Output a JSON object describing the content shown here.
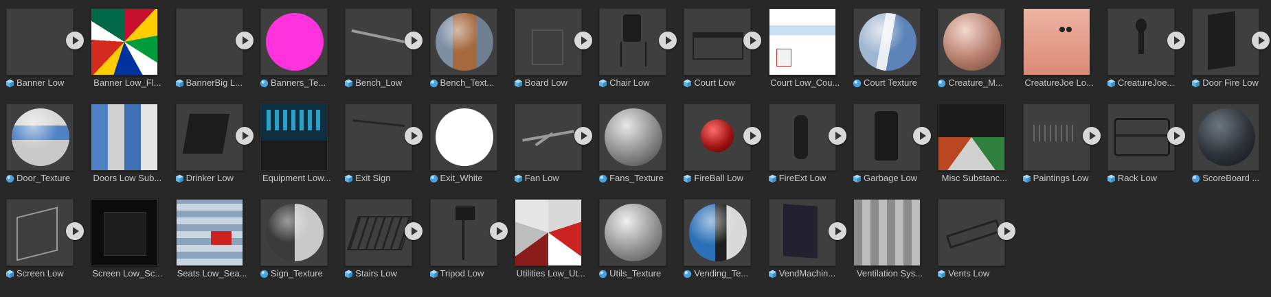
{
  "assets": [
    {
      "name": "Banner Low",
      "kind": "model",
      "thumb": "empty"
    },
    {
      "name": "Banner Low_Fl...",
      "kind": "texture",
      "thumb": "flags"
    },
    {
      "name": "BannerBig L...",
      "kind": "model",
      "thumb": "empty"
    },
    {
      "name": "Banners_Te...",
      "kind": "material",
      "thumb": "sphere-flags"
    },
    {
      "name": "Bench_Low",
      "kind": "model",
      "thumb": "bench"
    },
    {
      "name": "Bench_Text...",
      "kind": "material",
      "thumb": "sphere-bench"
    },
    {
      "name": "Board Low",
      "kind": "model",
      "thumb": "board"
    },
    {
      "name": "Chair Low",
      "kind": "model",
      "thumb": "chair"
    },
    {
      "name": "Court Low",
      "kind": "model",
      "thumb": "court"
    },
    {
      "name": "Court Low_Cou...",
      "kind": "texture",
      "thumb": "court-tex"
    },
    {
      "name": "Court Texture",
      "kind": "material",
      "thumb": "sphere-court"
    },
    {
      "name": "Creature_M...",
      "kind": "material",
      "thumb": "sphere-creature"
    },
    {
      "name": "CreatureJoe Lo...",
      "kind": "texture",
      "thumb": "creature-tex"
    },
    {
      "name": "CreatureJoe...",
      "kind": "model",
      "thumb": "creature"
    },
    {
      "name": "Door Fire Low",
      "kind": "model",
      "thumb": "door"
    },
    {
      "name": "Door_Texture",
      "kind": "material",
      "thumb": "sphere-door"
    },
    {
      "name": "Doors Low Sub...",
      "kind": "texture",
      "thumb": "doors-tex"
    },
    {
      "name": "Drinker Low",
      "kind": "model",
      "thumb": "drinker"
    },
    {
      "name": "Equipment Low...",
      "kind": "texture",
      "thumb": "equipment-tex"
    },
    {
      "name": "Exit Sign",
      "kind": "model",
      "thumb": "exitsign"
    },
    {
      "name": "Exit_White",
      "kind": "material",
      "thumb": "sphere-white"
    },
    {
      "name": "Fan Low",
      "kind": "model",
      "thumb": "fan"
    },
    {
      "name": "Fans_Texture",
      "kind": "material",
      "thumb": "sphere-fans"
    },
    {
      "name": "FireBall Low",
      "kind": "model",
      "thumb": "fireball"
    },
    {
      "name": "FireExt Low",
      "kind": "model",
      "thumb": "fireext"
    },
    {
      "name": "Garbage Low",
      "kind": "model",
      "thumb": "garbage"
    },
    {
      "name": "Misc Substanc...",
      "kind": "texture",
      "thumb": "misc-tex"
    },
    {
      "name": "Paintings Low",
      "kind": "model",
      "thumb": "paintings"
    },
    {
      "name": "Rack Low",
      "kind": "model",
      "thumb": "rack"
    },
    {
      "name": "ScoreBoard ...",
      "kind": "material",
      "thumb": "sphere-score"
    },
    {
      "name": "Screen Low",
      "kind": "model",
      "thumb": "screen"
    },
    {
      "name": "Screen Low_Sc...",
      "kind": "texture",
      "thumb": "screen-tex"
    },
    {
      "name": "Seats Low_Sea...",
      "kind": "texture",
      "thumb": "seats-tex"
    },
    {
      "name": "Sign_Texture",
      "kind": "material",
      "thumb": "sphere-sign"
    },
    {
      "name": "Stairs Low",
      "kind": "model",
      "thumb": "stairs"
    },
    {
      "name": "Tripod Low",
      "kind": "model",
      "thumb": "tripod"
    },
    {
      "name": "Utilities Low_Ut...",
      "kind": "texture",
      "thumb": "utilities-tex"
    },
    {
      "name": "Utils_Texture",
      "kind": "material",
      "thumb": "sphere-utils"
    },
    {
      "name": "Vending_Te...",
      "kind": "material",
      "thumb": "sphere-vending"
    },
    {
      "name": "VendMachin...",
      "kind": "model",
      "thumb": "vendmachine"
    },
    {
      "name": "Ventilation Sys...",
      "kind": "texture",
      "thumb": "vent-tex"
    },
    {
      "name": "Vents Low",
      "kind": "model",
      "thumb": "vents"
    }
  ],
  "colors": {
    "background": "#282828",
    "tile": "#3f3f3f",
    "label": "#c8c8c8",
    "model_icon": "#5fb3e6",
    "material_icon": "#4aa3df",
    "play_button": "#d9d9d9"
  }
}
